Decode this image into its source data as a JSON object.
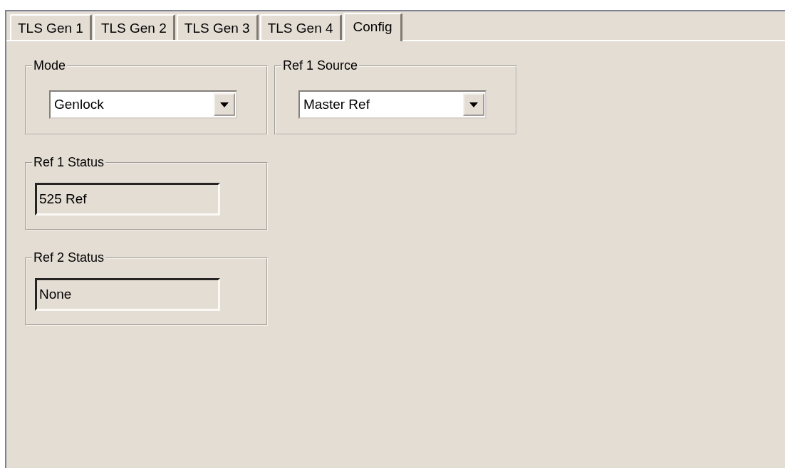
{
  "tabs": [
    {
      "label": "TLS Gen 1",
      "selected": false
    },
    {
      "label": "TLS Gen 2",
      "selected": false
    },
    {
      "label": "TLS Gen 3",
      "selected": false
    },
    {
      "label": "TLS Gen 4",
      "selected": false
    },
    {
      "label": "Config",
      "selected": true
    }
  ],
  "groups": [
    {
      "title": "Mode",
      "kind": "dropdown",
      "value": "Genlock"
    },
    {
      "title": "Ref 1  Source",
      "kind": "dropdown",
      "value": "Master Ref"
    },
    {
      "title": "Ref 1 Status",
      "kind": "status",
      "value": "525 Ref"
    },
    {
      "title": "Ref 2 Status",
      "kind": "status",
      "value": "None"
    }
  ]
}
